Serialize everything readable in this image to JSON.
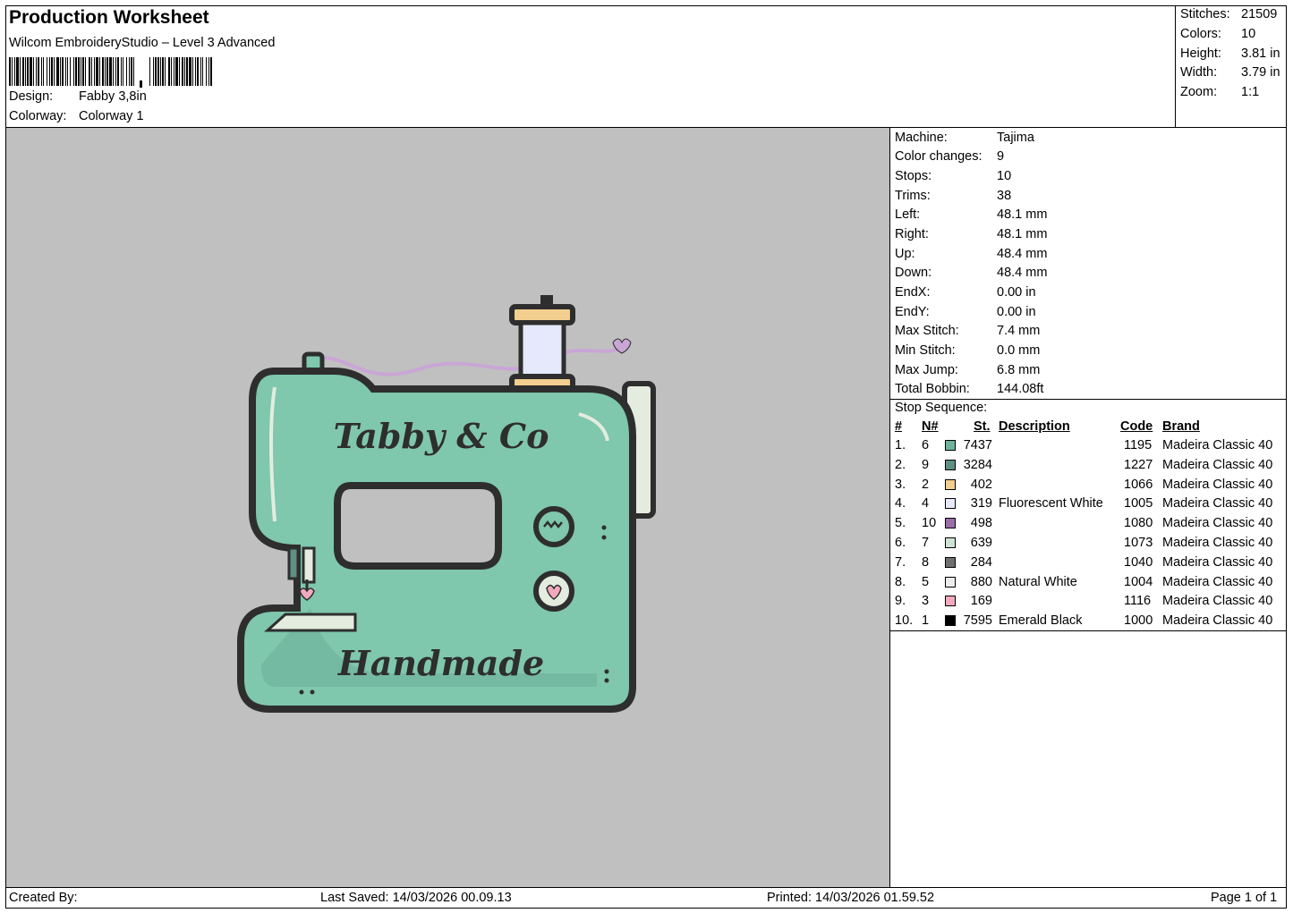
{
  "header": {
    "title": "Production Worksheet",
    "software": "Wilcom EmbroideryStudio – Level 3 Advanced",
    "design_label": "Design:",
    "design_value": "Fabby 3,8in",
    "colorway_label": "Colorway:",
    "colorway_value": "Colorway 1"
  },
  "stats": [
    {
      "label": "Stitches:",
      "value": "21509"
    },
    {
      "label": "Colors:",
      "value": "10"
    },
    {
      "label": "Height:",
      "value": "3.81 in"
    },
    {
      "label": "Width:",
      "value": "3.79 in"
    },
    {
      "label": "Zoom:",
      "value": "1:1"
    }
  ],
  "machine_info": [
    {
      "label": "Machine:",
      "value": "Tajima"
    },
    {
      "label": "Color changes:",
      "value": "9"
    },
    {
      "label": "Stops:",
      "value": "10"
    },
    {
      "label": "Trims:",
      "value": "38"
    },
    {
      "label": "Left:",
      "value": "48.1 mm"
    },
    {
      "label": "Right:",
      "value": "48.1 mm"
    },
    {
      "label": "Up:",
      "value": "48.4 mm"
    },
    {
      "label": "Down:",
      "value": "48.4 mm"
    },
    {
      "label": "EndX:",
      "value": "0.00 in"
    },
    {
      "label": "EndY:",
      "value": "0.00 in"
    },
    {
      "label": "Max Stitch:",
      "value": "7.4 mm"
    },
    {
      "label": "Min Stitch:",
      "value": "0.0 mm"
    },
    {
      "label": "Max Jump:",
      "value": "6.8 mm"
    },
    {
      "label": "Total Bobbin:",
      "value": "144.08ft"
    }
  ],
  "stop_sequence": {
    "title": "Stop Sequence:",
    "columns": {
      "index": "#",
      "needle": "N#",
      "stitches": "St.",
      "description": "Description",
      "code": "Code",
      "brand": "Brand"
    },
    "rows": [
      {
        "index": "1.",
        "needle": "6",
        "color": "#6fb39c",
        "stitches": "7437",
        "description": "",
        "code": "1195",
        "brand": "Madeira Classic 40"
      },
      {
        "index": "2.",
        "needle": "9",
        "color": "#5f8f85",
        "stitches": "3284",
        "description": "",
        "code": "1227",
        "brand": "Madeira Classic 40"
      },
      {
        "index": "3.",
        "needle": "2",
        "color": "#f2cf8f",
        "stitches": "402",
        "description": "",
        "code": "1066",
        "brand": "Madeira Classic 40"
      },
      {
        "index": "4.",
        "needle": "4",
        "color": "#e6e9fb",
        "stitches": "319",
        "description": "Fluorescent White",
        "code": "1005",
        "brand": "Madeira Classic 40"
      },
      {
        "index": "5.",
        "needle": "10",
        "color": "#9a6fa8",
        "stitches": "498",
        "description": "",
        "code": "1080",
        "brand": "Madeira Classic 40"
      },
      {
        "index": "6.",
        "needle": "7",
        "color": "#cfe3d4",
        "stitches": "639",
        "description": "",
        "code": "1073",
        "brand": "Madeira Classic 40"
      },
      {
        "index": "7.",
        "needle": "8",
        "color": "#707070",
        "stitches": "284",
        "description": "",
        "code": "1040",
        "brand": "Madeira Classic 40"
      },
      {
        "index": "8.",
        "needle": "5",
        "color": "#ececec",
        "stitches": "880",
        "description": "Natural White",
        "code": "1004",
        "brand": "Madeira Classic 40"
      },
      {
        "index": "9.",
        "needle": "3",
        "color": "#f3a9bd",
        "stitches": "169",
        "description": "",
        "code": "1116",
        "brand": "Madeira Classic 40"
      },
      {
        "index": "10.",
        "needle": "1",
        "color": "#000000",
        "stitches": "7595",
        "description": "Emerald Black",
        "code": "1000",
        "brand": "Madeira Classic 40"
      }
    ]
  },
  "design_preview": {
    "top_text": "Tabby & Co",
    "bottom_text": "Handmade",
    "body_color": "#7fc7ad",
    "outline_color": "#2e2e2e",
    "thread_color": "#c9a6d6",
    "background": "#c0c0c0"
  },
  "footer": {
    "created_by": "Created By:",
    "last_saved": "Last Saved: 14/03/2026 00.09.13",
    "printed": "Printed: 14/03/2026 01.59.52",
    "page": "Page 1 of 1"
  }
}
